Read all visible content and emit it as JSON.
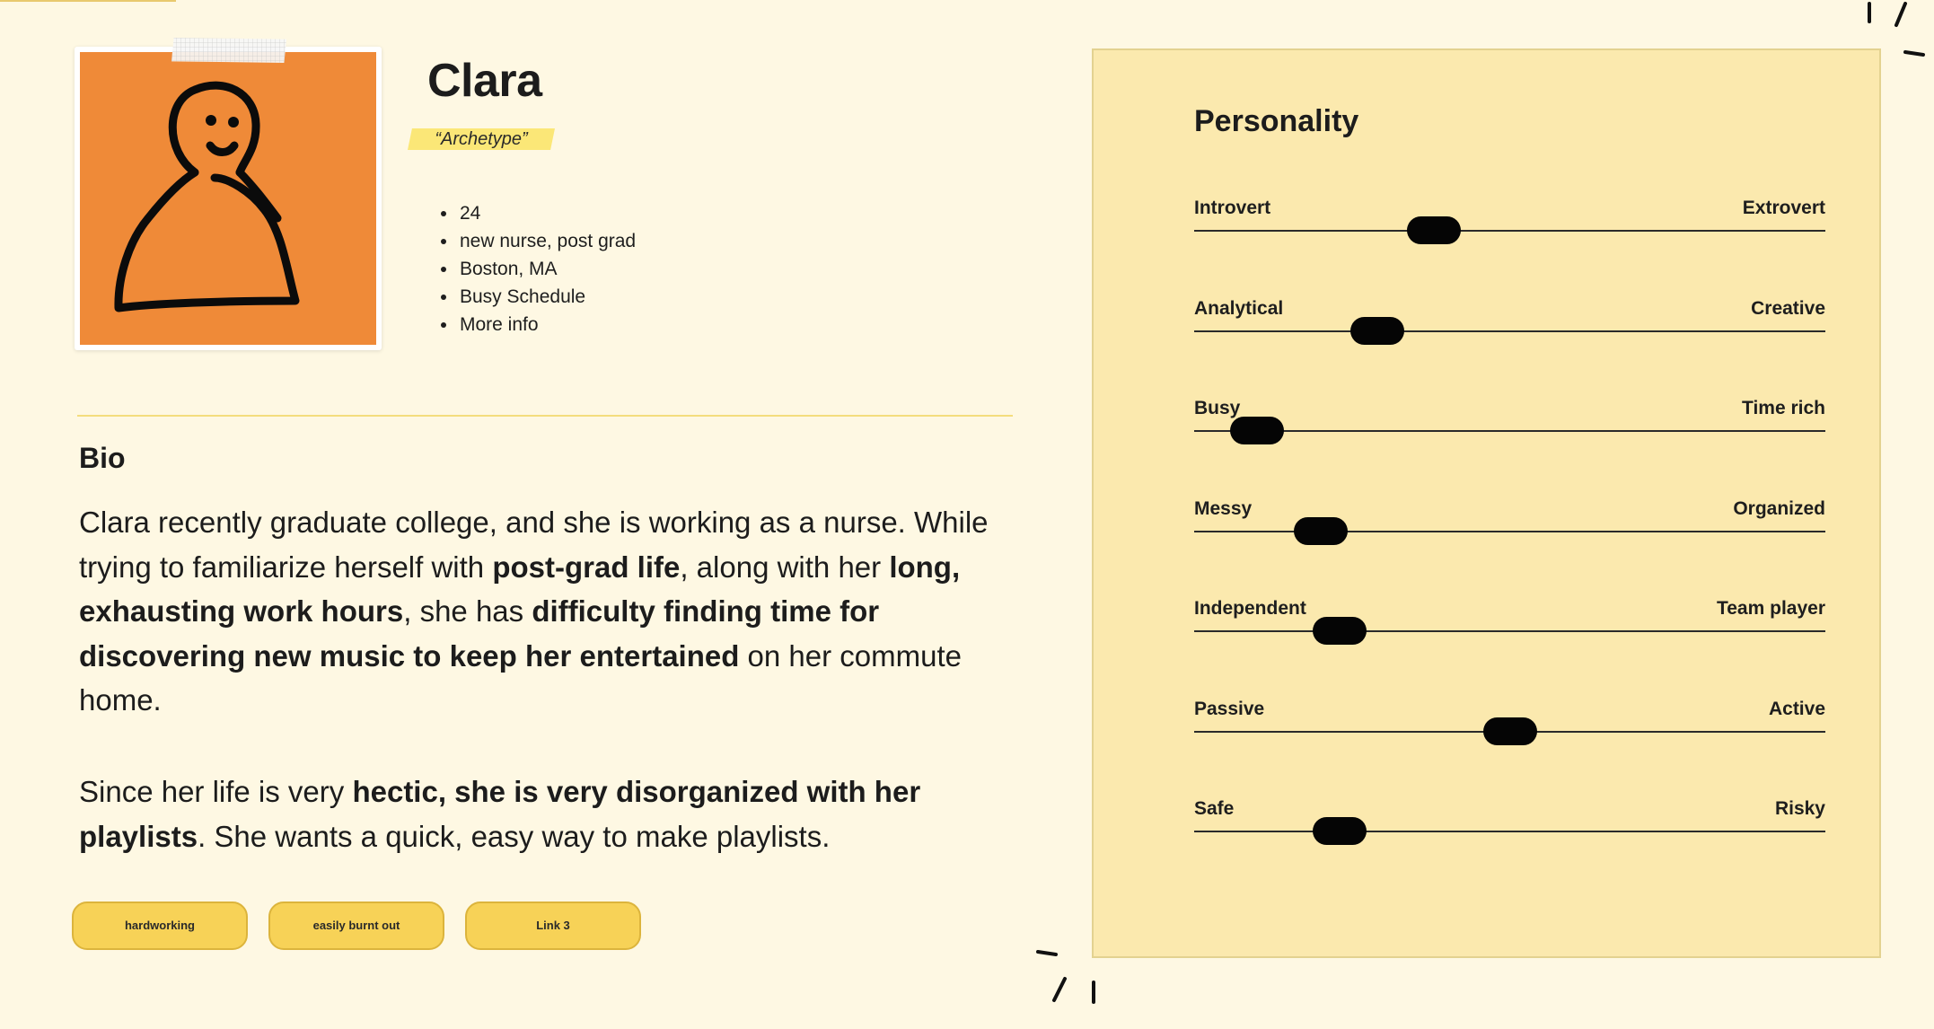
{
  "persona": {
    "name": "Clara",
    "archetype": "“Archetype”",
    "facts": [
      "24",
      "new nurse, post grad",
      "Boston, MA",
      "Busy Schedule",
      "More info"
    ]
  },
  "bio": {
    "heading": "Bio",
    "paragraph1": [
      {
        "text": "Clara recently graduate college, and she is working as a nurse. While trying to familiarize herself with ",
        "bold": false
      },
      {
        "text": "post-grad life",
        "bold": true
      },
      {
        "text": ", along with her ",
        "bold": false
      },
      {
        "text": "long, exhausting work hours",
        "bold": true
      },
      {
        "text": ", she has ",
        "bold": false
      },
      {
        "text": "difficulty finding time for discovering new music to keep her entertained",
        "bold": true
      },
      {
        "text": " on her commute home.",
        "bold": false
      }
    ],
    "paragraph2": [
      {
        "text": "Since her life is very ",
        "bold": false
      },
      {
        "text": "hectic, she is very disorganized with her playlists",
        "bold": true
      },
      {
        "text": ". She wants a quick, easy way to make playlists.",
        "bold": false
      }
    ]
  },
  "tags": [
    "hardworking",
    "easily burnt out",
    "Link 3"
  ],
  "personality": {
    "heading": "Personality",
    "traits": [
      {
        "left": "Introvert",
        "right": "Extrovert",
        "value": 0.38
      },
      {
        "left": "Analytical",
        "right": "Creative",
        "value": 0.29
      },
      {
        "left": "Busy",
        "right": "Time rich",
        "value": 0.1
      },
      {
        "left": "Messy",
        "right": "Organized",
        "value": 0.2
      },
      {
        "left": "Independent",
        "right": "Team player",
        "value": 0.23
      },
      {
        "left": "Passive",
        "right": "Active",
        "value": 0.5
      },
      {
        "left": "Safe",
        "right": "Risky",
        "value": 0.23
      }
    ]
  },
  "colors": {
    "background": "#fef8e3",
    "avatar_bg": "#ef8a38",
    "panel_bg": "#fbe9ae",
    "tag_bg": "#f7d257",
    "highlight": "#fbe777",
    "slider_thumb": "#050505"
  }
}
